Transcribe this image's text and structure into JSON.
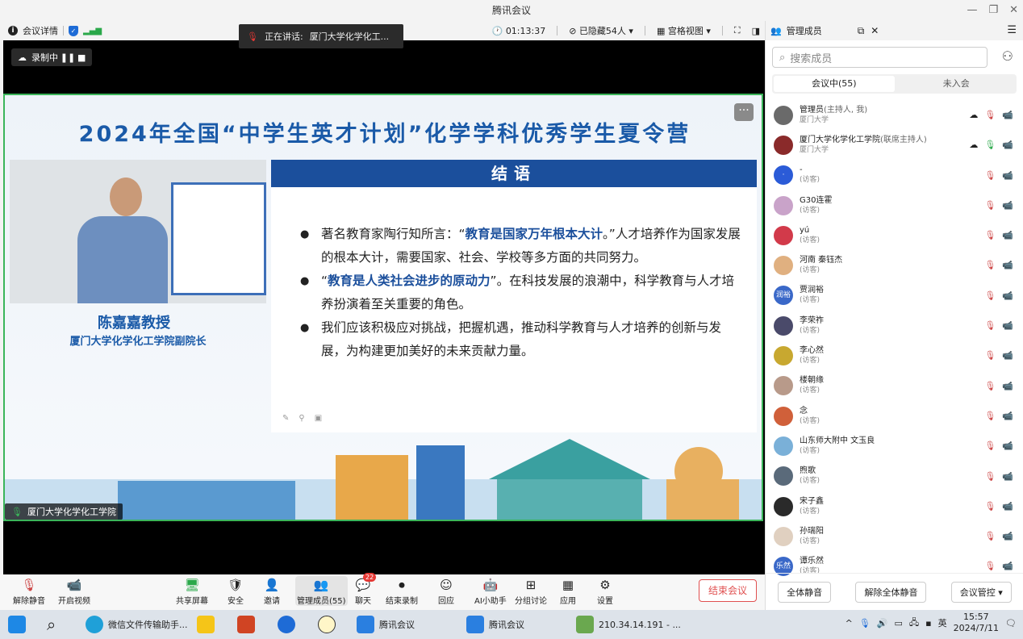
{
  "window": {
    "title": "腾讯会议",
    "minimize": "—",
    "restore": "❐",
    "close": "✕"
  },
  "topbar": {
    "meeting_info": "会议详情",
    "timer": "01:13:37",
    "hidden_count": "已隐藏54人",
    "view_mode": "宫格视图"
  },
  "speaking": {
    "label": "正在讲话:",
    "name": "厦门大学化学化工..."
  },
  "recording": {
    "label": "录制中"
  },
  "slide": {
    "title": "2024年全国“中学生英才计划”化学学科优秀学生夏令营",
    "presenter_name": "陈嘉嘉教授",
    "presenter_title": "厦门大学化学化工学院副院长",
    "section_title": "结语",
    "bullets": [
      {
        "pre": "著名教育家陶行知所言：“",
        "bold": "教育是国家万年根本大计",
        "post": "。”人才培养作为国家发展的根本大计，需要国家、社会、学校等多方面的共同努力。"
      },
      {
        "pre": "“",
        "bold": "教育是人类社会进步的原动力",
        "post": "”。在科技发展的浪潮中，科学教育与人才培养扮演着至关重要的角色。"
      },
      {
        "pre": "我们应该积极应对挑战，把握机遇，推动科学教育与人才培养的创新与发展，为构建更加美好的未来贡献力量。",
        "bold": "",
        "post": ""
      }
    ]
  },
  "camera_label": "厦门大学化学化工学院",
  "sidebar": {
    "title": "管理成员",
    "search_placeholder": "搜索成员",
    "tab_in": "会议中(55)",
    "tab_out": "未入会",
    "members": [
      {
        "name": "管理员",
        "role": "(主持人, 我)",
        "sub": "厦门大学",
        "color": "#6a6a6a",
        "initial": ""
      },
      {
        "name": "厦门大学化学化工学院",
        "role": "(联席主持人)",
        "sub": "厦门大学",
        "color": "#8a2a2a",
        "initial": ""
      },
      {
        "name": "-",
        "role": "",
        "sub": "(访客)",
        "color": "#2b5bd7",
        "initial": "·"
      },
      {
        "name": "G30连霍",
        "role": "",
        "sub": "(访客)",
        "color": "#c9a3c9",
        "initial": ""
      },
      {
        "name": "yú",
        "role": "",
        "sub": "(访客)",
        "color": "#d23a4a",
        "initial": ""
      },
      {
        "name": "河南 秦钰杰",
        "role": "",
        "sub": "(访客)",
        "color": "#e0b080",
        "initial": ""
      },
      {
        "name": "贾润裕",
        "role": "",
        "sub": "(访客)",
        "color": "#3a68c8",
        "initial": "润裕"
      },
      {
        "name": "李荣祚",
        "role": "",
        "sub": "(访客)",
        "color": "#4a4a6a",
        "initial": ""
      },
      {
        "name": "李心然",
        "role": "",
        "sub": "(访客)",
        "color": "#c8a830",
        "initial": ""
      },
      {
        "name": "楼朝缘",
        "role": "",
        "sub": "(访客)",
        "color": "#b89a8a",
        "initial": ""
      },
      {
        "name": "念",
        "role": "",
        "sub": "(访客)",
        "color": "#d0603a",
        "initial": ""
      },
      {
        "name": "山东师大附中 文玉良",
        "role": "",
        "sub": "(访客)",
        "color": "#7ab0d8",
        "initial": ""
      },
      {
        "name": "煦歌",
        "role": "",
        "sub": "(访客)",
        "color": "#5a6a7a",
        "initial": ""
      },
      {
        "name": "宋子鑫",
        "role": "",
        "sub": "(访客)",
        "color": "#2a2a2a",
        "initial": ""
      },
      {
        "name": "孙瑞阳",
        "role": "",
        "sub": "(访客)",
        "color": "#e0d0c0",
        "initial": ""
      },
      {
        "name": "谭乐然",
        "role": "",
        "sub": "(访客)",
        "color": "#3a68c8",
        "initial": "乐然"
      }
    ],
    "footer": {
      "mute_all": "全体静音",
      "unmute_all": "解除全体静音",
      "control": "会议管控 ▾"
    }
  },
  "toolbar": {
    "unmute": "解除静音",
    "video": "开启视频",
    "share": "共享屏幕",
    "security": "安全",
    "invite": "邀请",
    "members": "管理成员(55)",
    "chat": "聊天",
    "chat_badge": "22",
    "end_record": "结束录制",
    "react": "回应",
    "ai": "AI小助手",
    "breakout": "分组讨论",
    "apps": "应用",
    "settings": "设置",
    "end_meeting": "结束会议"
  },
  "taskbar": {
    "wechat": "微信文件传输助手...",
    "meeting1": "腾讯会议",
    "meeting2": "腾讯会议",
    "remote": "210.34.14.191 - ...",
    "ime": "英",
    "time": "15:57",
    "date": "2024/7/11"
  }
}
